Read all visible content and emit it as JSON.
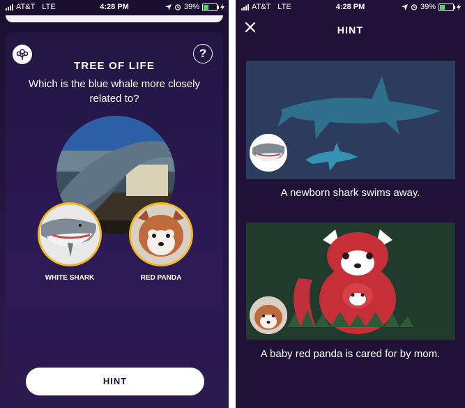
{
  "status_left": {
    "carrier": "AT&T",
    "network": "LTE",
    "time": "4:28 PM",
    "battery": "39%"
  },
  "status_right": {
    "carrier": "AT&T",
    "network": "LTE",
    "time": "4:28 PM",
    "battery": "39%"
  },
  "quiz": {
    "title": "TREE OF LIFE",
    "question": "Which is the blue whale more closely related to?",
    "help_label": "?",
    "choices": [
      {
        "label": "WHITE SHARK"
      },
      {
        "label": "RED PANDA"
      }
    ],
    "hint_button": "HINT"
  },
  "hint": {
    "title": "HINT",
    "items": [
      {
        "caption": "A newborn shark swims away."
      },
      {
        "caption": "A baby red panda is cared for by mom."
      }
    ]
  },
  "colors": {
    "accent": "#f5b51b",
    "background": "#1f1236",
    "shark_panel": "#2a3a5b",
    "panda_panel": "#1f3a2b"
  }
}
